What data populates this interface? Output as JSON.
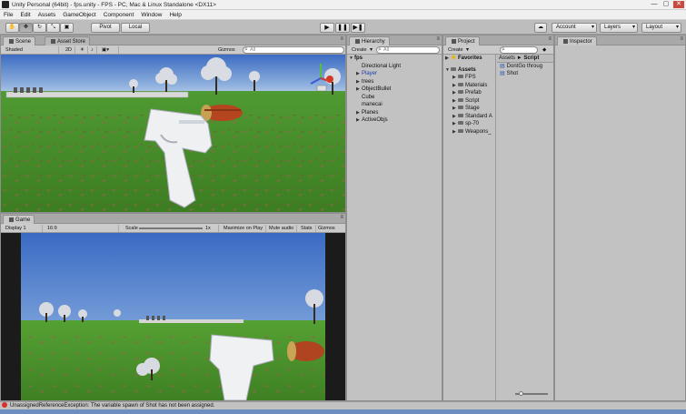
{
  "window": {
    "title": "Unity Personal (64bit) - fps.unity - FPS - PC, Mac & Linux Standalone <DX11>"
  },
  "menu": [
    "File",
    "Edit",
    "Assets",
    "GameObject",
    "Component",
    "Window",
    "Help"
  ],
  "toolbar": {
    "pivot_label": "Pivot",
    "local_label": "Local",
    "play_icon": "▶",
    "pause_icon": "❚❚",
    "step_icon": "▶❚",
    "cloud_icon": "☁",
    "account_label": "Account",
    "layers_label": "Layers",
    "layout_label": "Layout"
  },
  "scene": {
    "tab_scene": "Scene",
    "tab_asset_store": "Asset Store",
    "shading": "Shaded",
    "mode_2d": "2D",
    "gizmos": "Gizmos",
    "search_placeholder": "All"
  },
  "game": {
    "tab": "Game",
    "display": "Display 1",
    "aspect": "16:9",
    "scale_label": "Scale",
    "scale_value": "1x",
    "maximize": "Maximize on Play",
    "mute": "Mute audio",
    "stats": "Stats",
    "gizmos": "Gizmos"
  },
  "hierarchy": {
    "tab": "Hierarchy",
    "create": "Create",
    "search_placeholder": "All",
    "root": "fps",
    "items": [
      {
        "label": "Directional Light",
        "expand": "",
        "blue": false
      },
      {
        "label": "Player",
        "expand": "▶",
        "blue": true
      },
      {
        "label": "trees",
        "expand": "▶",
        "blue": false
      },
      {
        "label": "ObjectBullet",
        "expand": "▶",
        "blue": false
      },
      {
        "label": "Cube",
        "expand": "",
        "blue": false
      },
      {
        "label": "manecai",
        "expand": "",
        "blue": false
      },
      {
        "label": "Planes",
        "expand": "▶",
        "blue": false
      },
      {
        "label": "ActiveObjs",
        "expand": "▶",
        "blue": false
      }
    ]
  },
  "project": {
    "tab": "Project",
    "create": "Create",
    "favorites": "Favorites",
    "assets": "Assets",
    "folders": [
      "FPS",
      "Materials",
      "Prefab",
      "Script",
      "Stage",
      "Standard A",
      "sp-70",
      "Weapons_"
    ],
    "breadcrumb_root": "Assets",
    "breadcrumb_sep": "►",
    "breadcrumb_current": "Script",
    "files": [
      "DontGo throug",
      "Shot"
    ]
  },
  "inspector": {
    "tab": "Inspector"
  },
  "status": {
    "message": "UnassignedReferenceException: The variable spawn of Shot has not been assigned."
  }
}
